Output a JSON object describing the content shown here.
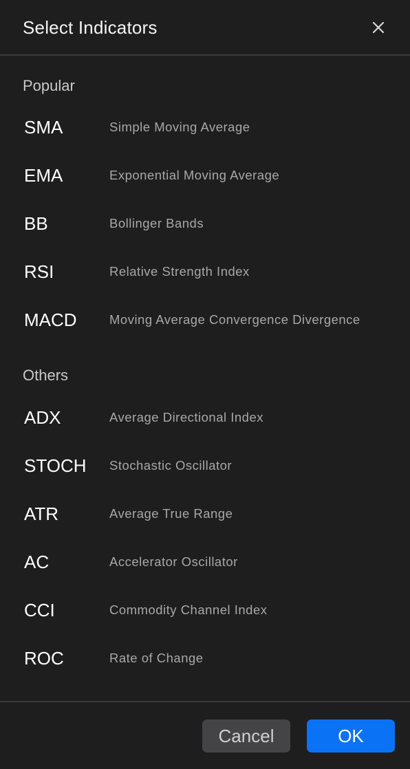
{
  "dialog": {
    "title": "Select Indicators",
    "close_icon": "close-icon"
  },
  "sections": [
    {
      "label": "Popular",
      "items": [
        {
          "abbr": "SMA",
          "name": "Simple Moving Average"
        },
        {
          "abbr": "EMA",
          "name": "Exponential Moving Average"
        },
        {
          "abbr": "BB",
          "name": "Bollinger Bands"
        },
        {
          "abbr": "RSI",
          "name": "Relative Strength Index"
        },
        {
          "abbr": "MACD",
          "name": "Moving Average Convergence Divergence"
        }
      ]
    },
    {
      "label": "Others",
      "items": [
        {
          "abbr": "ADX",
          "name": "Average Directional Index"
        },
        {
          "abbr": "STOCH",
          "name": "Stochastic Oscillator"
        },
        {
          "abbr": "ATR",
          "name": "Average True Range"
        },
        {
          "abbr": "AC",
          "name": "Accelerator Oscillator"
        },
        {
          "abbr": "CCI",
          "name": "Commodity Channel Index"
        },
        {
          "abbr": "ROC",
          "name": "Rate of Change"
        }
      ]
    }
  ],
  "footer": {
    "cancel_label": "Cancel",
    "ok_label": "OK"
  },
  "colors": {
    "background": "#1e1e1f",
    "primary_button": "#0a72f5",
    "secondary_button": "#444446"
  }
}
